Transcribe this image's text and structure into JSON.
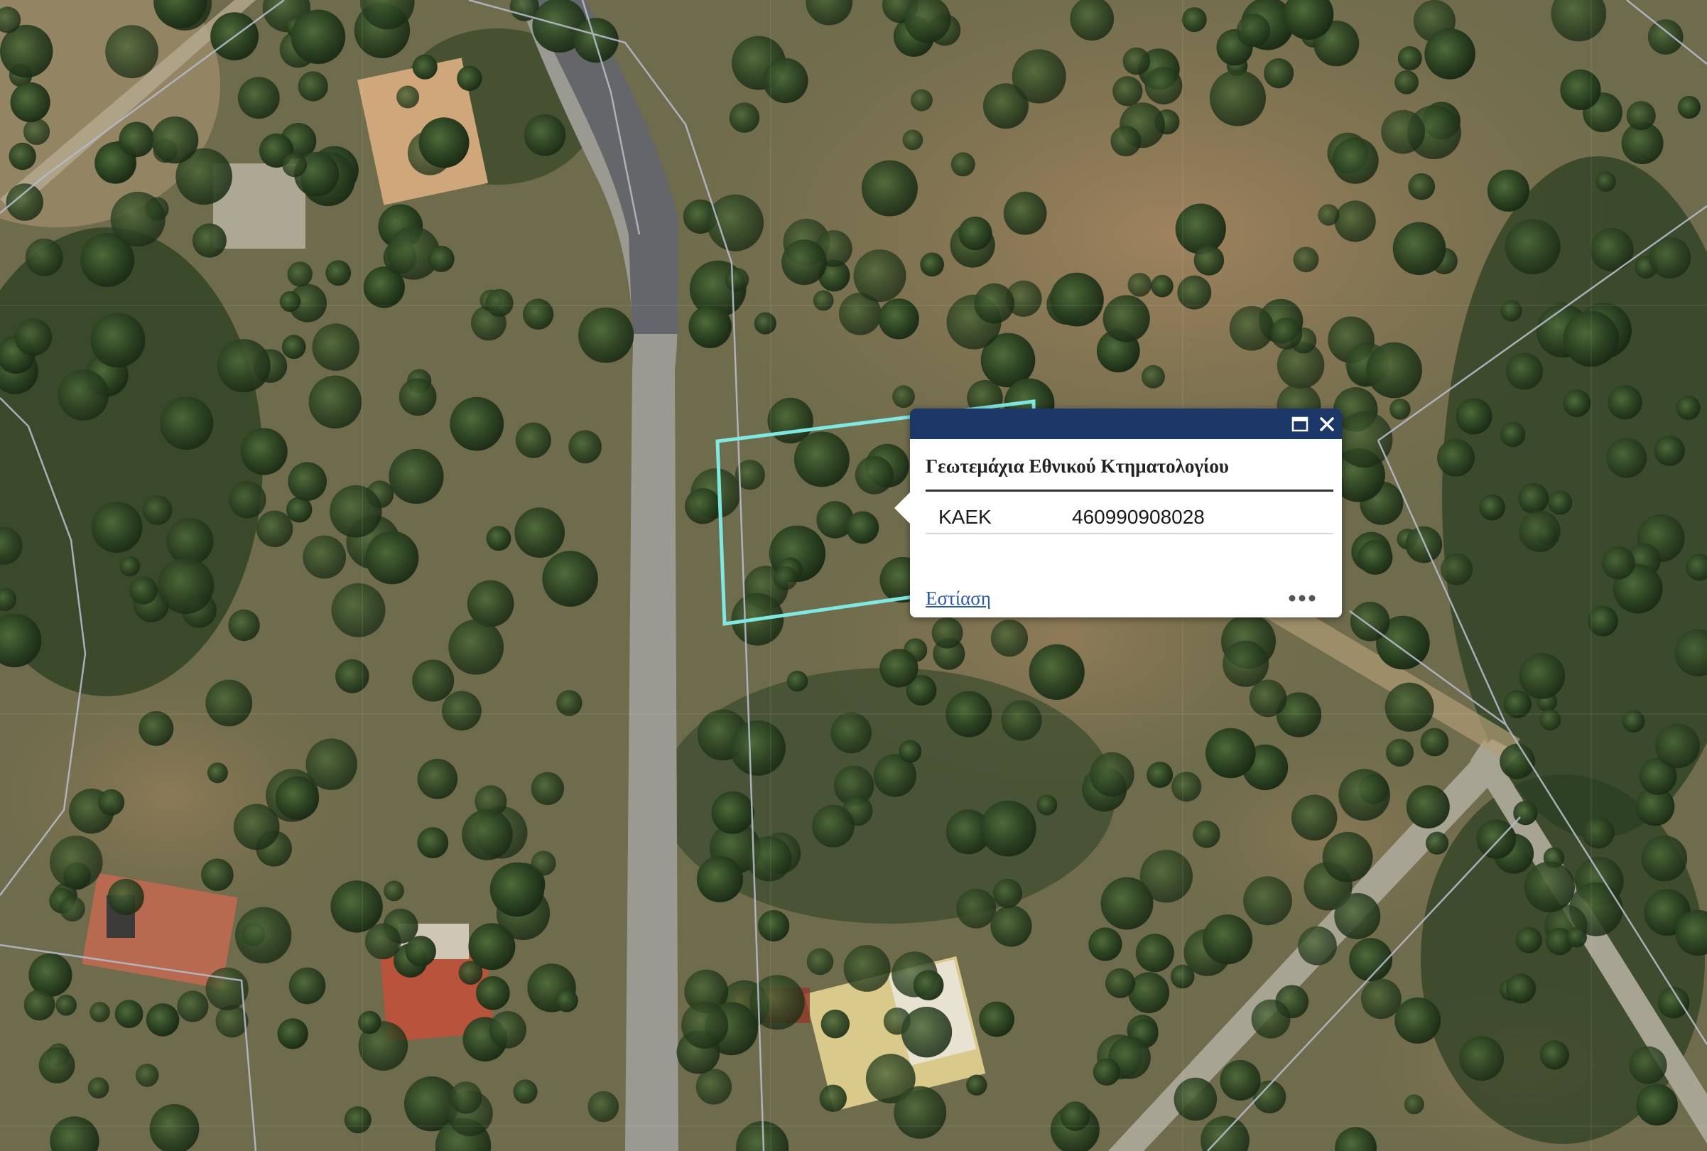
{
  "map": {
    "basemap": "satellite-imagery",
    "parcel_outline_color": "#7fe8e0",
    "boundary_line_color": "#b6b9c8"
  },
  "popup": {
    "title": "Γεωτεμάχια Εθνικού Κτηματολογίου",
    "attributes": [
      {
        "key": "ΚΑΕΚ",
        "value": "460990908028"
      }
    ],
    "zoom_label": "Εστίαση",
    "header_color": "#1c3868",
    "icons": {
      "maximize": "maximize-icon",
      "close": "close-icon",
      "more": "more-options-icon"
    }
  }
}
